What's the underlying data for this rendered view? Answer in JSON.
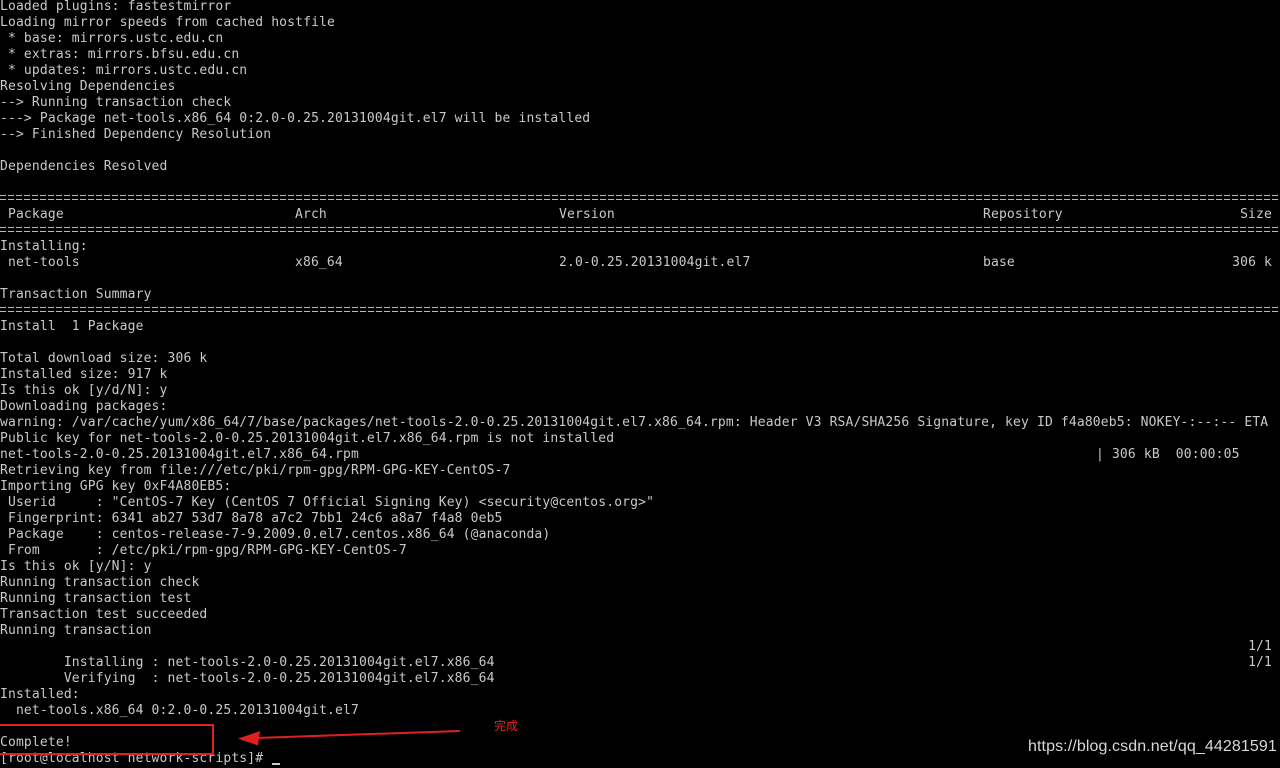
{
  "terminal": {
    "lines_top": [
      "Loaded plugins: fastestmirror",
      "Loading mirror speeds from cached hostfile",
      " * base: mirrors.ustc.edu.cn",
      " * extras: mirrors.bfsu.edu.cn",
      " * updates: mirrors.ustc.edu.cn",
      "Resolving Dependencies",
      "--> Running transaction check",
      "---> Package net-tools.x86_64 0:2.0-0.25.20131004git.el7 will be installed",
      "--> Finished Dependency Resolution",
      "",
      "Dependencies Resolved"
    ],
    "table": {
      "headers": {
        "package": " Package",
        "arch": "Arch",
        "version": "Version",
        "repository": "Repository",
        "size": "Size"
      },
      "section": "Installing:",
      "row": {
        "package": " net-tools",
        "arch": "x86_64",
        "version": "2.0-0.25.20131004git.el7",
        "repository": "base",
        "size": "306 k"
      }
    },
    "summary": {
      "title": "Transaction Summary",
      "install": "Install  1 Package"
    },
    "lines_mid": [
      "Total download size: 306 k",
      "Installed size: 917 k",
      "Is this ok [y/d/N]: y",
      "Downloading packages:",
      "warning: /var/cache/yum/x86_64/7/base/packages/net-tools-2.0-0.25.20131004git.el7.x86_64.rpm: Header V3 RSA/SHA256 Signature, key ID f4a80eb5: NOKEY-:--:-- ETA",
      "Public key for net-tools-2.0-0.25.20131004git.el7.x86_64.rpm is not installed"
    ],
    "download_line": {
      "file": "net-tools-2.0-0.25.20131004git.el7.x86_64.rpm",
      "stats": "| 306 kB  00:00:05"
    },
    "lines_key": [
      "Retrieving key from file:///etc/pki/rpm-gpg/RPM-GPG-KEY-CentOS-7",
      "Importing GPG key 0xF4A80EB5:",
      " Userid     : \"CentOS-7 Key (CentOS 7 Official Signing Key) <security@centos.org>\"",
      " Fingerprint: 6341 ab27 53d7 8a78 a7c2 7bb1 24c6 a8a7 f4a8 0eb5",
      " Package    : centos-release-7-9.2009.0.el7.centos.x86_64 (@anaconda)",
      " From       : /etc/pki/rpm-gpg/RPM-GPG-KEY-CentOS-7",
      "Is this ok [y/N]: y",
      "Running transaction check",
      "Running transaction test",
      "Transaction test succeeded",
      "Running transaction"
    ],
    "progress": [
      {
        "text": "  Installing : net-tools-2.0-0.25.20131004git.el7.x86_64",
        "count": "1/1"
      },
      {
        "text": "  Verifying  : net-tools-2.0-0.25.20131004git.el7.x86_64",
        "count": "1/1"
      }
    ],
    "installed_header": "Installed:",
    "installed_pkg": "  net-tools.x86_64 0:2.0-0.25.20131004git.el7",
    "complete": "Complete!",
    "prompt": "[root@localhost network-scripts]# "
  },
  "annotation": {
    "label": "完成",
    "color": "#e02020"
  },
  "watermark": "https://blog.csdn.net/qq_44281591"
}
